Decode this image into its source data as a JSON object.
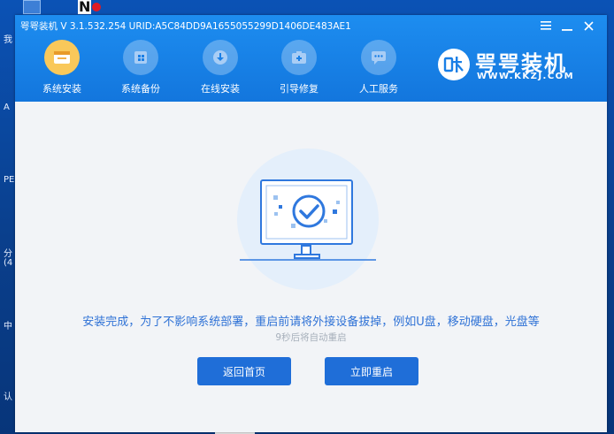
{
  "desktop": {
    "side_labels": [
      "我",
      "A",
      "PE",
      "分",
      "(4",
      "中",
      "认"
    ]
  },
  "window": {
    "title": "咢咢装机 V 3.1.532.254 URID:A5C84DD9A1655055299D1406DE483AE1",
    "controls": {
      "menu": "≡",
      "minimize": "—",
      "close": "✕"
    }
  },
  "nav": {
    "items": [
      {
        "label": "系统安装",
        "icon": "system-install-icon",
        "active": true
      },
      {
        "label": "系统备份",
        "icon": "system-backup-icon",
        "active": false
      },
      {
        "label": "在线安装",
        "icon": "online-install-icon",
        "active": false
      },
      {
        "label": "引导修复",
        "icon": "boot-repair-icon",
        "active": false
      },
      {
        "label": "人工服务",
        "icon": "chat-service-icon",
        "active": false
      }
    ]
  },
  "brand": {
    "logo_text": "咢",
    "name": "咢咢装机",
    "url": "WWW.KKZJ.COM"
  },
  "content": {
    "message": "安装完成，为了不影响系统部署，重启前请将外接设备拔掉，例如U盘，移动硬盘，光盘等",
    "countdown": "9秒后将自动重启",
    "back_button": "返回首页",
    "restart_button": "立即重启"
  },
  "colors": {
    "header_blue": "#1a86ea",
    "accent_blue": "#2f72d6",
    "button_blue": "#1f6ed8",
    "active_icon": "#f9c85a"
  }
}
